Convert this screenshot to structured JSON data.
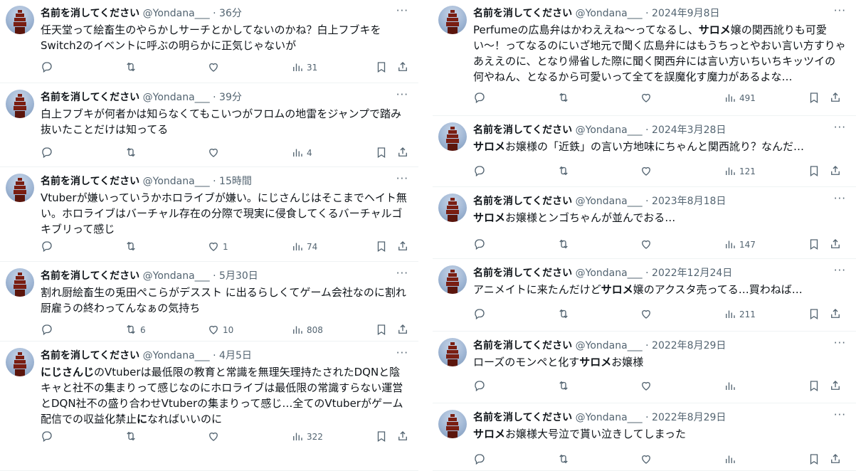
{
  "user": {
    "name": "名前を消してください",
    "handle": "@Yondana___"
  },
  "left_tweets": [
    {
      "time": "36分",
      "segments": [
        {
          "t": "任天堂って絵畜生のやらかしサーチとかしてないのかね？白上フブキをSwitch2のイベントに呼ぶの明らかに正気じゃないが",
          "b": false
        }
      ],
      "replies": "",
      "retweets": "",
      "likes": "",
      "views": "31"
    },
    {
      "time": "39分",
      "segments": [
        {
          "t": "白上フブキが何者かは知らなくてもこいつがフロムの地雷をジャンプで踏み抜いたことだけは知ってる",
          "b": false
        }
      ],
      "replies": "",
      "retweets": "",
      "likes": "",
      "views": "4"
    },
    {
      "time": "15時間",
      "segments": [
        {
          "t": "Vtuberが嫌いっていうかホロライブが嫌い。にじさんじはそこまでヘイト無い。ホロライブはバーチャル存在の分際で現実に侵食してくるバーチャルゴキブリって感じ",
          "b": false
        }
      ],
      "replies": "",
      "retweets": "",
      "likes": "1",
      "views": "74"
    },
    {
      "time": "5月30日",
      "segments": [
        {
          "t": "割れ厨絵畜生の兎田ぺこらがデススト に出るらしくてゲーム会社なのに割れ厨雇うの終わってんなぁの気持ち",
          "b": false
        }
      ],
      "replies": "",
      "retweets": "6",
      "likes": "10",
      "views": "808"
    },
    {
      "time": "4月5日",
      "segments": [
        {
          "t": "にじさんじ",
          "b": true
        },
        {
          "t": "のVtuberは最低限の教育と常識を無理矢理持たされたDQNと陰キャと社不の集まりって感じなのにホロライブは最低限の常識すらない運営とDQN社不の盛り合わせVtuberの集まりって感じ…全てのVtuberがゲーム配信での収益化禁止",
          "b": false
        },
        {
          "t": "に",
          "b": true
        },
        {
          "t": "なればいいのに",
          "b": false
        }
      ],
      "replies": "",
      "retweets": "",
      "likes": "",
      "views": "322"
    }
  ],
  "right_tweets": [
    {
      "time": "2024年9月8日",
      "segments": [
        {
          "t": "Perfumeの広島弁はかわええね〜ってなるし、",
          "b": false
        },
        {
          "t": "サロメ",
          "b": true
        },
        {
          "t": "嬢の関西訛りも可愛い〜！ってなるのにいざ地元で聞く広島弁にはもうちっとやおい言い方すりゃあええのに、となり帰省した際に聞く関西弁には言い方いちいちキッツイの何やねん、となるから可愛いって全てを誤魔化す魔力があるよな…",
          "b": false
        }
      ],
      "replies": "",
      "retweets": "",
      "likes": "",
      "views": "491"
    },
    {
      "time": "2024年3月28日",
      "segments": [
        {
          "t": "サロメ",
          "b": true
        },
        {
          "t": "お嬢様の「近鉄」の言い方地味にちゃんと関西訛り？なんだ…",
          "b": false
        }
      ],
      "replies": "",
      "retweets": "",
      "likes": "",
      "views": "121"
    },
    {
      "time": "2023年8月18日",
      "segments": [
        {
          "t": "サロメ",
          "b": true
        },
        {
          "t": "お嬢様とンゴちゃんが並んでおる…",
          "b": false
        }
      ],
      "replies": "",
      "retweets": "",
      "likes": "",
      "views": "147"
    },
    {
      "time": "2022年12月24日",
      "segments": [
        {
          "t": "アニメイトに来たんだけど",
          "b": false
        },
        {
          "t": "サロメ",
          "b": true
        },
        {
          "t": "嬢のアクスタ売ってる…買わねば…",
          "b": false
        }
      ],
      "replies": "",
      "retweets": "",
      "likes": "",
      "views": "211"
    },
    {
      "time": "2022年8月29日",
      "segments": [
        {
          "t": "ローズのモンペと化す",
          "b": false
        },
        {
          "t": "サロメ",
          "b": true
        },
        {
          "t": "お嬢様",
          "b": false
        }
      ],
      "replies": "",
      "retweets": "",
      "likes": "",
      "views": ""
    },
    {
      "time": "2022年8月29日",
      "segments": [
        {
          "t": "サロメ",
          "b": true
        },
        {
          "t": "お嬢様大号泣で貰い泣きしてしまった",
          "b": false
        }
      ],
      "replies": "",
      "retweets": "",
      "likes": "",
      "views": ""
    }
  ],
  "icons": {
    "more": "more-dots-icon",
    "reply": "reply-icon",
    "retweet": "retweet-icon",
    "like": "heart-icon",
    "views": "views-icon",
    "bookmark": "bookmark-icon",
    "share": "share-icon"
  },
  "colors": {
    "text": "#0f1419",
    "muted": "#536471",
    "border": "#eff3f4"
  }
}
